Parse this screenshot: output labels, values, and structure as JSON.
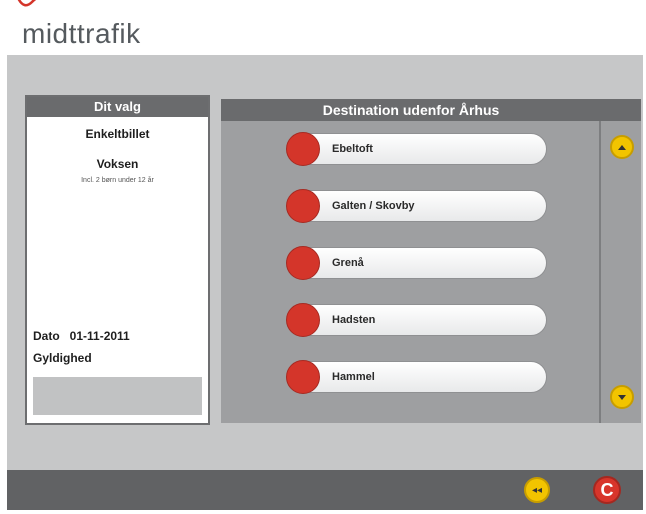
{
  "header": {
    "logo_text": "midttrafik",
    "logo_icon": "swirl-logo-icon"
  },
  "selection_panel": {
    "title": "Dit valg",
    "ticket_type": "Enkeltbillet",
    "passenger_type": "Voksen",
    "passenger_note": "Incl. 2 børn under 12 år",
    "date_label": "Dato",
    "date_value": "01-11-2011",
    "validity_label": "Gyldighed"
  },
  "destination_panel": {
    "title": "Destination udenfor Århus",
    "items": [
      {
        "label": "Ebeltoft"
      },
      {
        "label": "Galten / Skovby"
      },
      {
        "label": "Grenå"
      },
      {
        "label": "Hadsten"
      },
      {
        "label": "Hammel"
      }
    ],
    "scroll_up_icon": "chevron-up-icon",
    "scroll_down_icon": "chevron-down-icon"
  },
  "footer": {
    "back_symbol": "◂◂",
    "cancel_symbol": "C"
  },
  "colors": {
    "accent_red": "#d4352a",
    "accent_yellow": "#f2c400",
    "panel_gray": "#9e9fa1",
    "header_gray": "#6a6b6d"
  }
}
